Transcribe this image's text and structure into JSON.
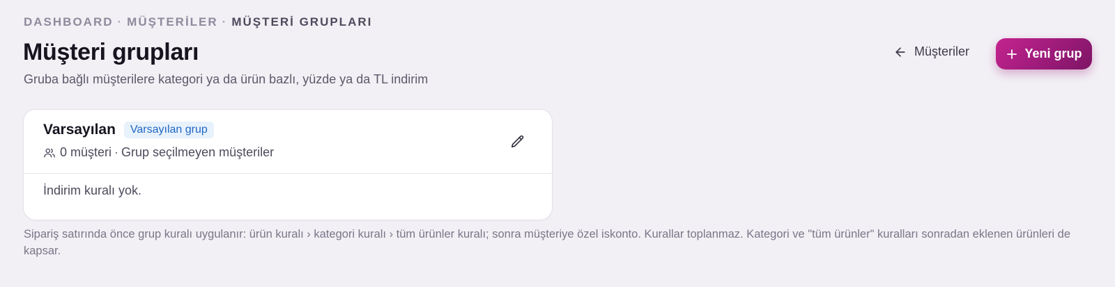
{
  "breadcrumb": {
    "items": [
      "DASHBOARD",
      "MÜŞTERİLER",
      "MÜŞTERİ GRUPLARI"
    ],
    "separator": "·"
  },
  "header": {
    "title": "Müşteri grupları",
    "subtitle": "Gruba bağlı müşterilere kategori ya da ürün bazlı, yüzde ya da TL indirim",
    "back_link_label": "Müşteriler",
    "new_button_label": "Yeni grup"
  },
  "groups": [
    {
      "name": "Varsayılan",
      "badge": "Varsayılan grup",
      "member_count": "0 müşteri",
      "meta_separator": "·",
      "description": "Grup seçilmeyen müşteriler",
      "rules_text": "İndirim kuralı yok."
    }
  ],
  "footer": {
    "note": "Sipariş satırında önce grup kuralı uygulanır: ürün kuralı › kategori kuralı › tüm ürünler kuralı; sonra müşteriye özel iskonto. Kurallar toplanmaz. Kategori ve \"tüm ürünler\" kuralları sonradan eklenen ürünleri de kapsar."
  },
  "colors": {
    "background": "#f2f0f5",
    "accent": "#a31d7e",
    "badge_bg": "#e8f2fd",
    "badge_text": "#1f66c2"
  },
  "icons": {
    "back": "arrow-left-icon",
    "new": "plus-icon",
    "members": "users-icon",
    "edit": "pencil-icon"
  }
}
